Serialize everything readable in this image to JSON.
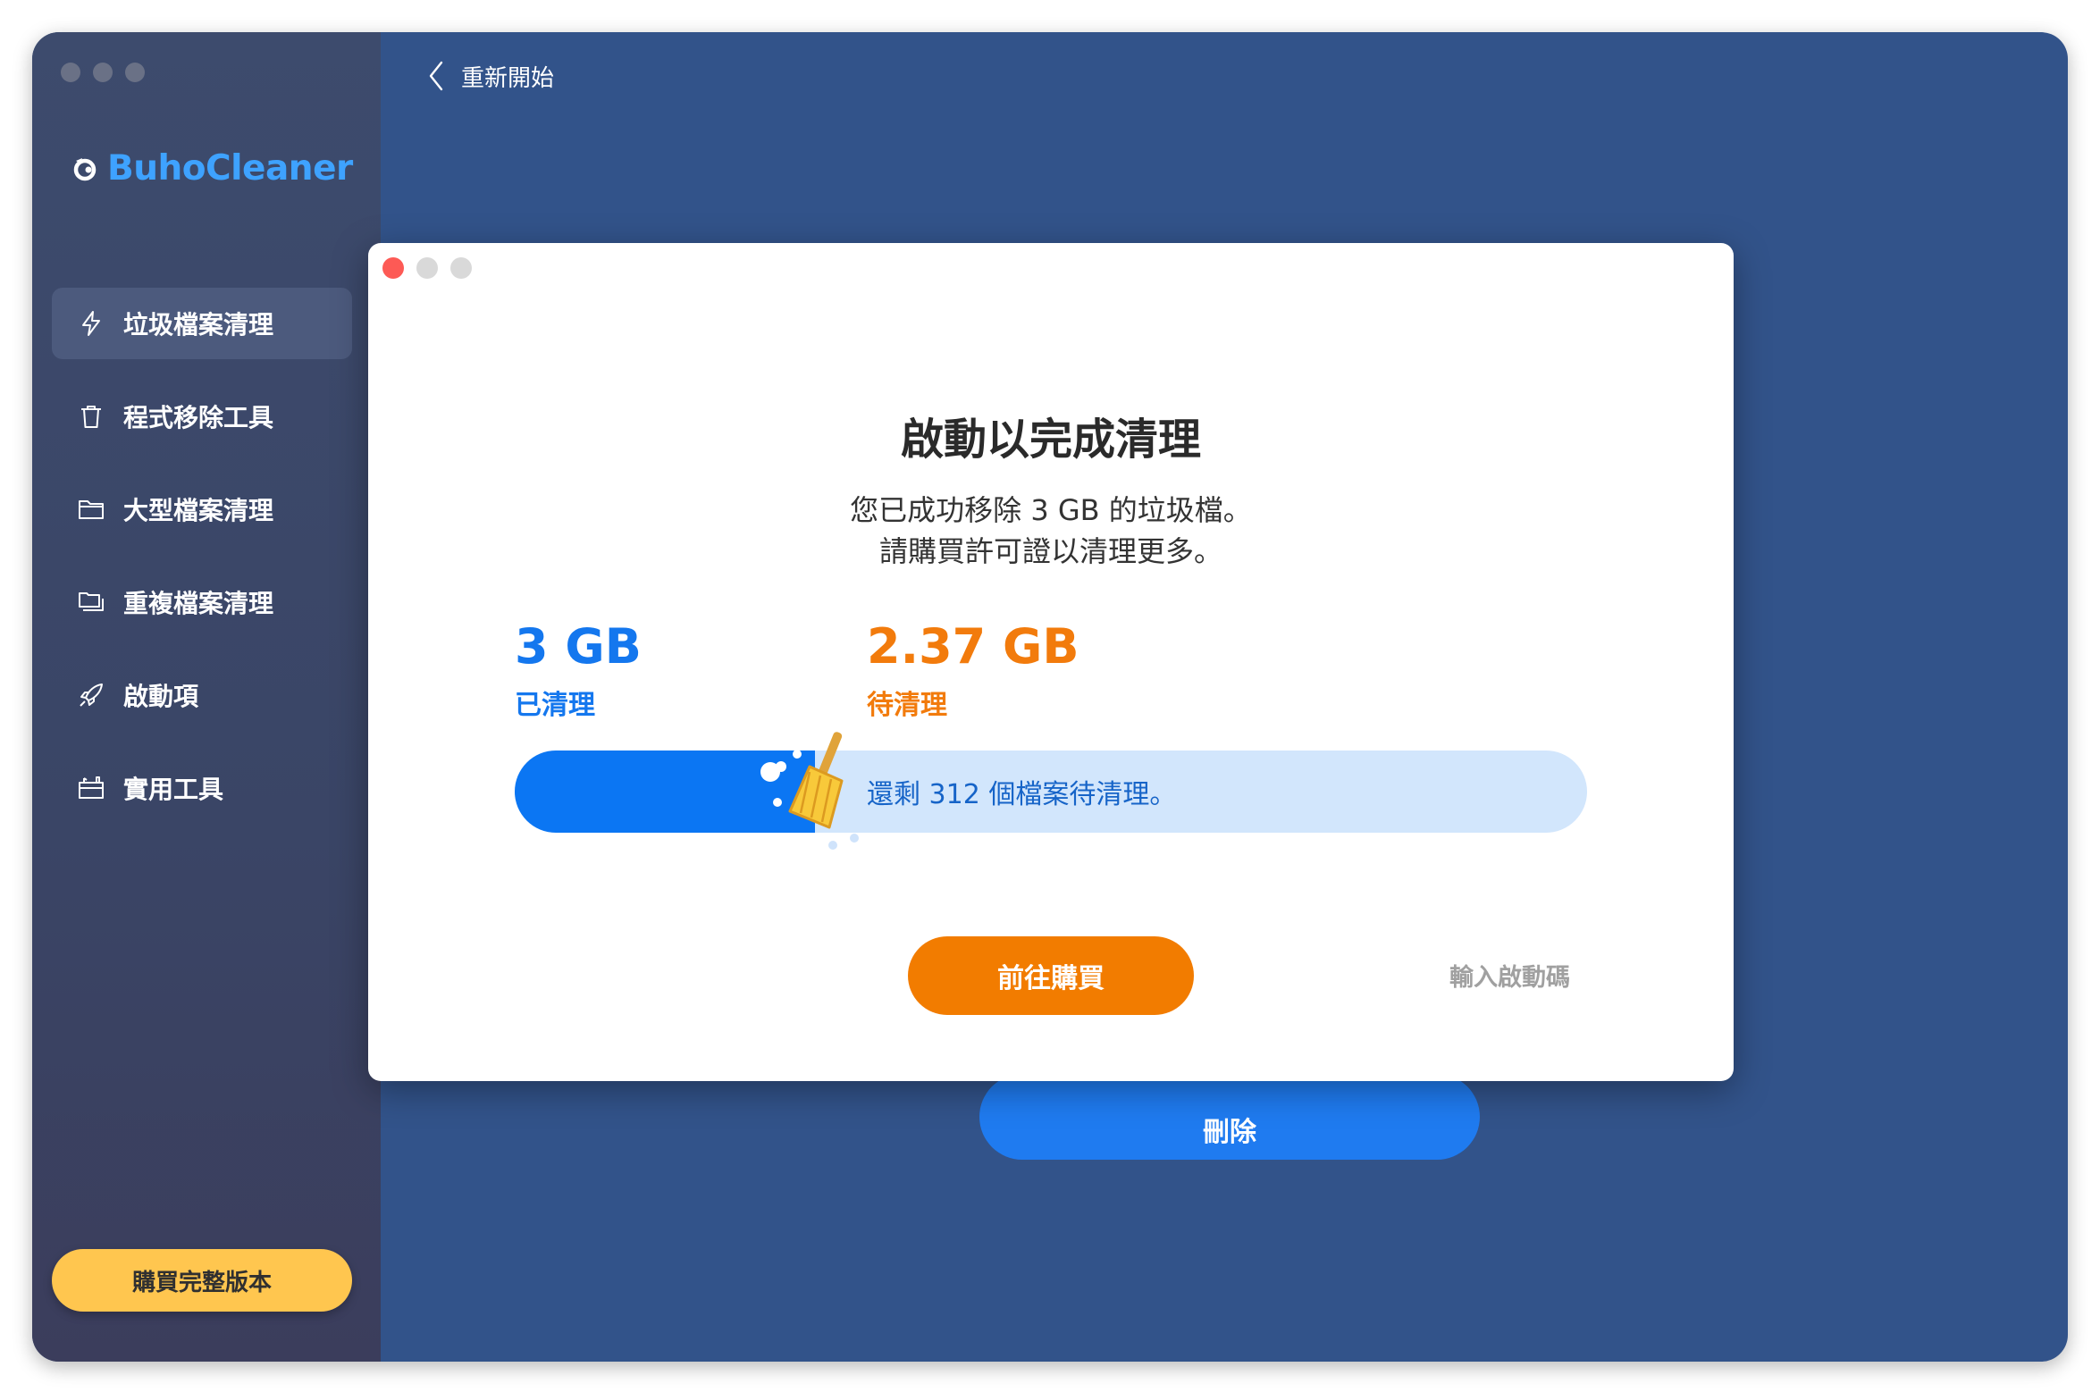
{
  "app": {
    "name": "BuhoCleaner"
  },
  "sidebar": {
    "items": [
      {
        "label": "垃圾檔案清理",
        "icon": "lightning-icon",
        "active": true
      },
      {
        "label": "程式移除工具",
        "icon": "trash-icon",
        "active": false
      },
      {
        "label": "大型檔案清理",
        "icon": "folder-icon",
        "active": false
      },
      {
        "label": "重複檔案清理",
        "icon": "duplicate-folder-icon",
        "active": false
      },
      {
        "label": "啟動項",
        "icon": "rocket-icon",
        "active": false
      },
      {
        "label": "實用工具",
        "icon": "toolbox-icon",
        "active": false
      }
    ],
    "buy_full_label": "購買完整版本"
  },
  "main": {
    "back_label": "重新開始",
    "delete_label": "刪除"
  },
  "dialog": {
    "title": "啟動以完成清理",
    "desc_line1": "您已成功移除 3 GB 的垃圾檔。",
    "desc_line2": "請購買許可證以清理更多。",
    "cleaned_value": "3 GB",
    "cleaned_label": "已清理",
    "pending_value": "2.37 GB",
    "pending_label": "待清理",
    "progress_text": "還剩 312 個檔案待清理。",
    "progress_fraction": 0.28,
    "buy_label": "前往購買",
    "enter_code_label": "輸入啟動碼"
  },
  "colors": {
    "accent_blue": "#1477ee",
    "accent_orange": "#f27c00",
    "sidebar_bg": "#3d4b6d",
    "main_bg": "#32538a",
    "buy_full_yellow": "#ffc64f"
  }
}
